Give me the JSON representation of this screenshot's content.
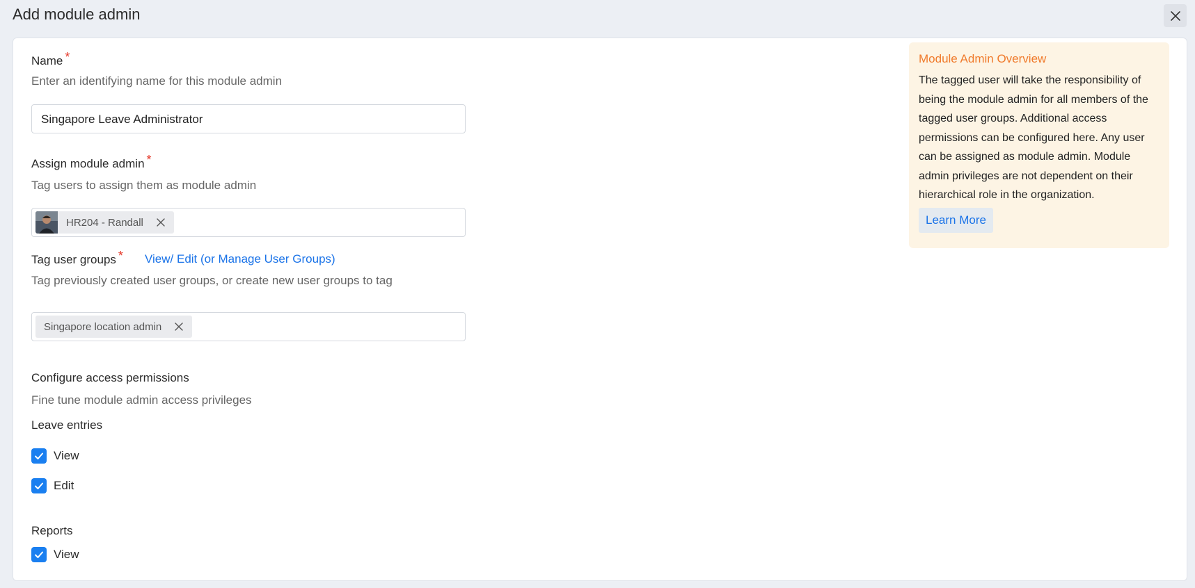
{
  "dialog": {
    "title": "Add module admin",
    "close_icon": "close-icon"
  },
  "form": {
    "name": {
      "label": "Name",
      "required_mark": "*",
      "description": "Enter an identifying name for this module admin",
      "value": "Singapore Leave Administrator"
    },
    "assign_admin": {
      "label": "Assign module admin",
      "required_mark": "*",
      "description": "Tag users to assign them as module admin",
      "chips": [
        {
          "label": "HR204 - Randall",
          "avatar": "user-avatar"
        }
      ]
    },
    "user_groups": {
      "label": "Tag user groups",
      "required_mark": "*",
      "link": "View/ Edit (or Manage User Groups)",
      "description": "Tag previously created user groups, or create new user groups to tag",
      "chips": [
        {
          "label": "Singapore location admin"
        }
      ]
    },
    "permissions": {
      "heading": "Configure access permissions",
      "description": "Fine tune module admin access privileges",
      "groups": [
        {
          "title": "Leave entries",
          "items": [
            {
              "label": "View",
              "checked": true
            },
            {
              "label": "Edit",
              "checked": true
            }
          ]
        },
        {
          "title": "Reports",
          "items": [
            {
              "label": "View",
              "checked": true
            }
          ]
        }
      ]
    }
  },
  "overview": {
    "title": "Module Admin Overview",
    "body": "The tagged user will take the responsibility of being the module admin for all members of the tagged user groups. Additional access permissions can be configured here. Any user can be assigned as module admin. Module admin privileges are not dependent on their hierarchical role in the organization.",
    "button": "Learn More"
  },
  "colors": {
    "accent": "#1a73e8",
    "checkbox": "#1a7ff0",
    "required": "#e5392a",
    "overview_title": "#f07a2b",
    "overview_bg": "#fdf4e4"
  }
}
